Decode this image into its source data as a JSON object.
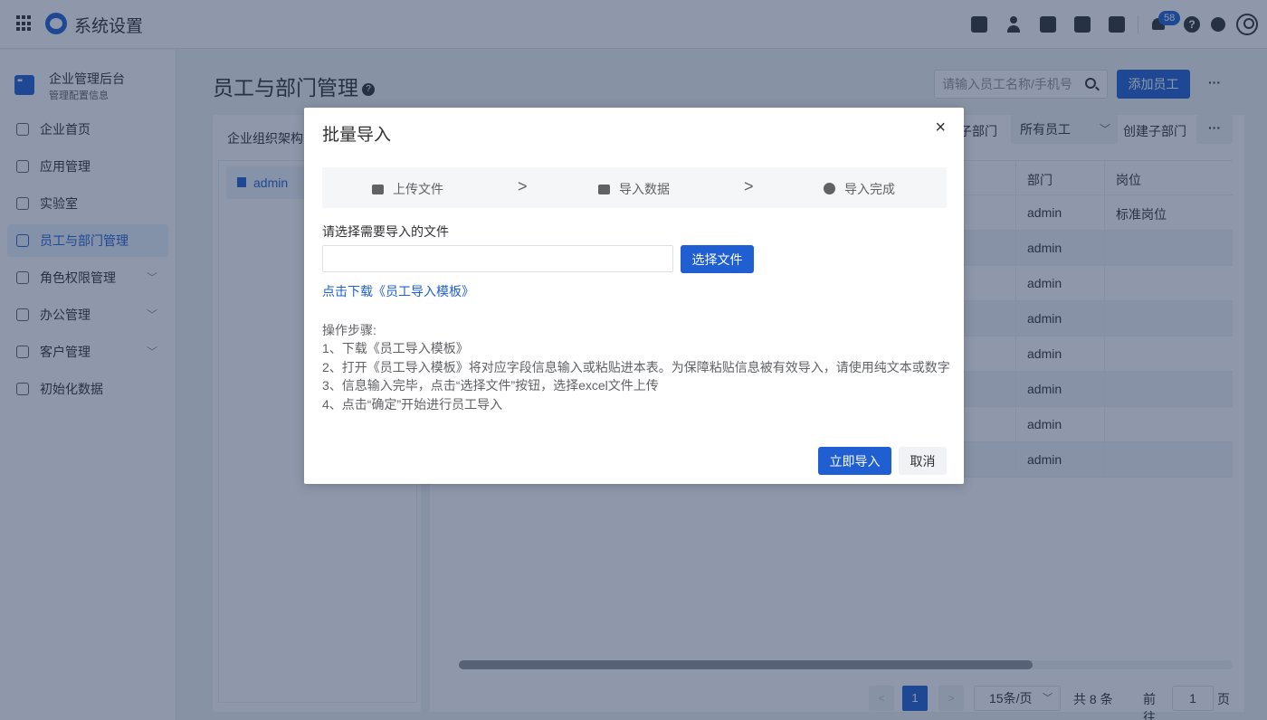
{
  "app": {
    "title": "系统设置"
  },
  "topbar": {
    "notification_count": "58",
    "help_glyph": "?"
  },
  "sidebar": {
    "org_name": "企业管理后台",
    "org_sub": "管理配置信息",
    "items": [
      {
        "label": "企业首页",
        "icon": "home-icon",
        "expandable": false,
        "active": false
      },
      {
        "label": "应用管理",
        "icon": "apps-icon",
        "expandable": false,
        "active": false
      },
      {
        "label": "实验室",
        "icon": "bulb-icon",
        "expandable": false,
        "active": false
      },
      {
        "label": "员工与部门管理",
        "icon": "users-icon",
        "expandable": false,
        "active": true
      },
      {
        "label": "角色权限管理",
        "icon": "role-icon",
        "expandable": true,
        "active": false
      },
      {
        "label": "办公管理",
        "icon": "office-icon",
        "expandable": true,
        "active": false
      },
      {
        "label": "客户管理",
        "icon": "customer-icon",
        "expandable": true,
        "active": false
      },
      {
        "label": "初始化数据",
        "icon": "init-icon",
        "expandable": false,
        "active": false
      }
    ]
  },
  "main": {
    "title": "员工与部门管理",
    "search_placeholder": "请输入员工名称/手机号",
    "add_button": "添加员工",
    "more": "···",
    "org_panel_title": "企业组织架构",
    "tree_root": "admin",
    "filter_label": "子部门",
    "filter_value": "所有员工",
    "create_sub": "创建子部门",
    "table": {
      "headers": {
        "dept": "部门",
        "position": "岗位"
      },
      "rows": [
        {
          "dept": "admin",
          "position": "标准岗位"
        },
        {
          "dept": "admin",
          "position": ""
        },
        {
          "dept": "admin",
          "position": ""
        },
        {
          "dept": "admin",
          "position": ""
        },
        {
          "dept": "admin",
          "position": ""
        },
        {
          "dept": "admin",
          "position": ""
        },
        {
          "dept": "admin",
          "position": ""
        },
        {
          "dept": "admin",
          "position": ""
        }
      ]
    },
    "pagination": {
      "prev": "<",
      "current": "1",
      "next": ">",
      "page_size": "15条/页",
      "total": "共 8 条",
      "goto": "前往",
      "goto_value": "1",
      "page_unit": "页"
    }
  },
  "modal": {
    "title": "批量导入",
    "close": "×",
    "steps": [
      "上传文件",
      "导入数据",
      "导入完成"
    ],
    "step_arrow": ">",
    "choose_label": "请选择需要导入的文件",
    "choose_button": "选择文件",
    "template_link": "点击下载《员工导入模板》",
    "instructions_title": "操作步骤:",
    "instructions": [
      "1、下载《员工导入模板》",
      "2、打开《员工导入模板》将对应字段信息输入或粘贴进本表。为保障粘贴信息被有效导入，请使用纯文本或数字",
      "3、信息输入完毕，点击“选择文件”按钮，选择excel文件上传",
      "4、点击“确定”开始进行员工导入"
    ],
    "confirm_button": "立即导入",
    "cancel_button": "取消"
  },
  "colors": {
    "accent": "#1f5fd1",
    "mask": "rgba(30,50,85,0.5)"
  }
}
